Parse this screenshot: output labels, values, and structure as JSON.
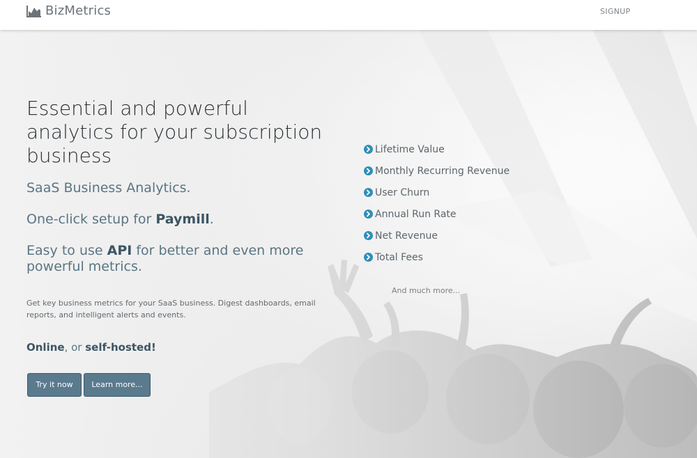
{
  "nav": {
    "brand": "BizMetrics",
    "brand_icon": "area-chart-icon",
    "signup": "SIGNUP"
  },
  "hero": {
    "headline": "Essential and powerful analytics for your subscription business",
    "subtitle": "SaaS Business Analytics.",
    "setup_prefix": "One-click setup for ",
    "setup_bold": "Paymill",
    "setup_suffix": ".",
    "api_prefix": "Easy to use ",
    "api_bold": "API",
    "api_suffix": " for better and even more powerful metrics.",
    "description": "Get key business metrics for your SaaS business. Digest dashboards, email reports, and intelligent alerts and events.",
    "online": "Online",
    "or": ", or ",
    "self_hosted": "self-hosted!",
    "try_button": "Try it now",
    "learn_button": "Learn more..."
  },
  "features": {
    "icon": "chevron-circle-right-icon",
    "items": [
      {
        "label": "Lifetime Value"
      },
      {
        "label": "Monthly Recurring Revenue"
      },
      {
        "label": "User Churn"
      },
      {
        "label": "Annual Run Rate"
      },
      {
        "label": "Net Revenue"
      },
      {
        "label": "Total Fees"
      }
    ],
    "much_more": "And much more..."
  },
  "colors": {
    "accent": "#2e8fb8",
    "button": "#5a7a8e",
    "heading": "#2a2f33",
    "subheading": "#5a7584"
  }
}
